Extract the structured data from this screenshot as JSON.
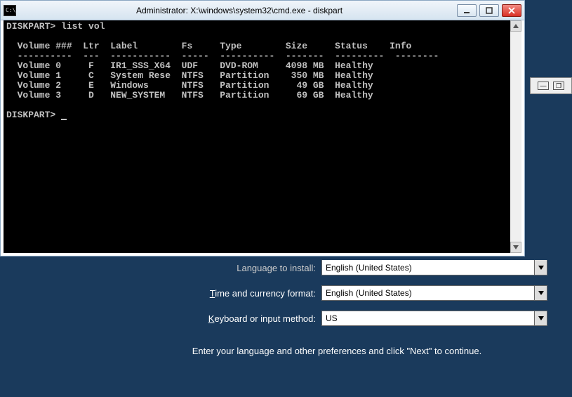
{
  "background_window": {
    "language_row": {
      "label": "Language to install:",
      "value": "English (United States)"
    },
    "time_row": {
      "label_pre": "T",
      "label_rest": "ime and currency format:",
      "value": "English (United States)"
    },
    "keyboard_row": {
      "label_pre": "K",
      "label_rest": "eyboard or input method:",
      "value": "US"
    },
    "hint": "Enter your language and other preferences and click \"Next\" to continue."
  },
  "cmd_window": {
    "title": "Administrator: X:\\windows\\system32\\cmd.exe - diskpart",
    "icon_text": "C:\\",
    "prompt1": "DISKPART> ",
    "command1": "list vol",
    "headers": {
      "volume": "Volume ###",
      "ltr": "Ltr",
      "label": "Label",
      "fs": "Fs",
      "type": "Type",
      "size": "Size",
      "status": "Status",
      "info": "Info"
    },
    "rows": [
      {
        "volume": "Volume 0",
        "ltr": "F",
        "label": "IR1_SSS_X64",
        "fs": "UDF",
        "type": "DVD-ROM",
        "size": "4098 MB",
        "status": "Healthy",
        "info": ""
      },
      {
        "volume": "Volume 1",
        "ltr": "C",
        "label": "System Rese",
        "fs": "NTFS",
        "type": "Partition",
        "size": "350 MB",
        "status": "Healthy",
        "info": ""
      },
      {
        "volume": "Volume 2",
        "ltr": "E",
        "label": "Windows",
        "fs": "NTFS",
        "type": "Partition",
        "size": "49 GB",
        "status": "Healthy",
        "info": ""
      },
      {
        "volume": "Volume 3",
        "ltr": "D",
        "label": "NEW_SYSTEM",
        "fs": "NTFS",
        "type": "Partition",
        "size": "69 GB",
        "status": "Healthy",
        "info": ""
      }
    ],
    "prompt2": "DISKPART> "
  },
  "chart_data": {
    "type": "table",
    "title": "list vol",
    "columns": [
      "Volume ###",
      "Ltr",
      "Label",
      "Fs",
      "Type",
      "Size",
      "Status",
      "Info"
    ],
    "rows": [
      [
        "Volume 0",
        "F",
        "IR1_SSS_X64",
        "UDF",
        "DVD-ROM",
        "4098 MB",
        "Healthy",
        ""
      ],
      [
        "Volume 1",
        "C",
        "System Rese",
        "NTFS",
        "Partition",
        "350 MB",
        "Healthy",
        ""
      ],
      [
        "Volume 2",
        "E",
        "Windows",
        "NTFS",
        "Partition",
        "49 GB",
        "Healthy",
        ""
      ],
      [
        "Volume 3",
        "D",
        "NEW_SYSTEM",
        "NTFS",
        "Partition",
        "69 GB",
        "Healthy",
        ""
      ]
    ]
  }
}
